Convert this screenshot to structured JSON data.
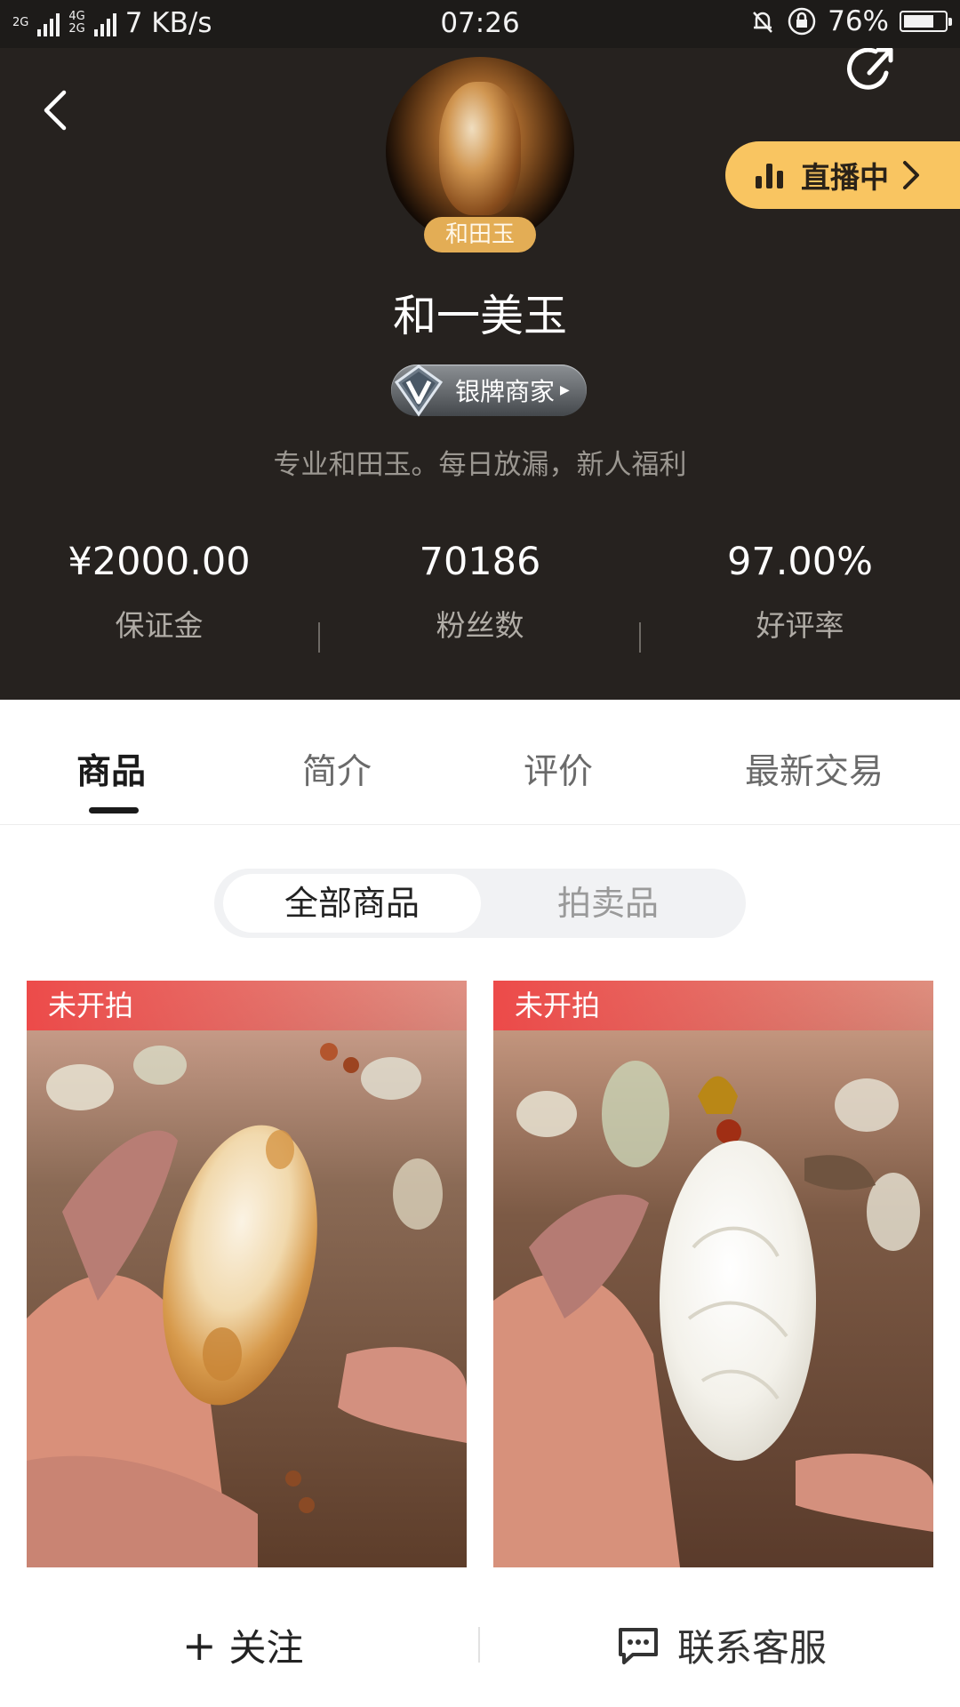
{
  "status_bar": {
    "signal_1": "2G",
    "signal_2_top": "4G",
    "signal_2_bottom": "2G",
    "speed": "7 KB/s",
    "time": "07:26",
    "battery": "76%",
    "battery_level": 0.76
  },
  "header": {
    "category_badge": "和田玉",
    "live_label": "直播中",
    "shop_name": "和一美玉",
    "merchant_level": "银牌商家",
    "description": "专业和田玉。每日放漏，新人福利",
    "stats": [
      {
        "value": "¥2000.00",
        "label": "保证金"
      },
      {
        "value": "70186",
        "label": "粉丝数"
      },
      {
        "value": "97.00%",
        "label": "好评率"
      }
    ]
  },
  "tabs": [
    {
      "label": "商品",
      "active": true
    },
    {
      "label": "简介",
      "active": false
    },
    {
      "label": "评价",
      "active": false
    },
    {
      "label": "最新交易",
      "active": false
    }
  ],
  "segments": {
    "all": "全部商品",
    "auction": "拍卖品"
  },
  "products": [
    {
      "badge": "未开拍",
      "image": "jade-pendant-yellow-skin-photo"
    },
    {
      "badge": "未开拍",
      "image": "white-jade-carved-pendant-photo"
    }
  ],
  "bottom_bar": {
    "follow": "关注",
    "service": "联系客服"
  },
  "colors": {
    "header_bg": "#26221f",
    "live_button": "#f9c561",
    "category_badge": "#e3ad55",
    "auction_badge": "#ee4646"
  }
}
